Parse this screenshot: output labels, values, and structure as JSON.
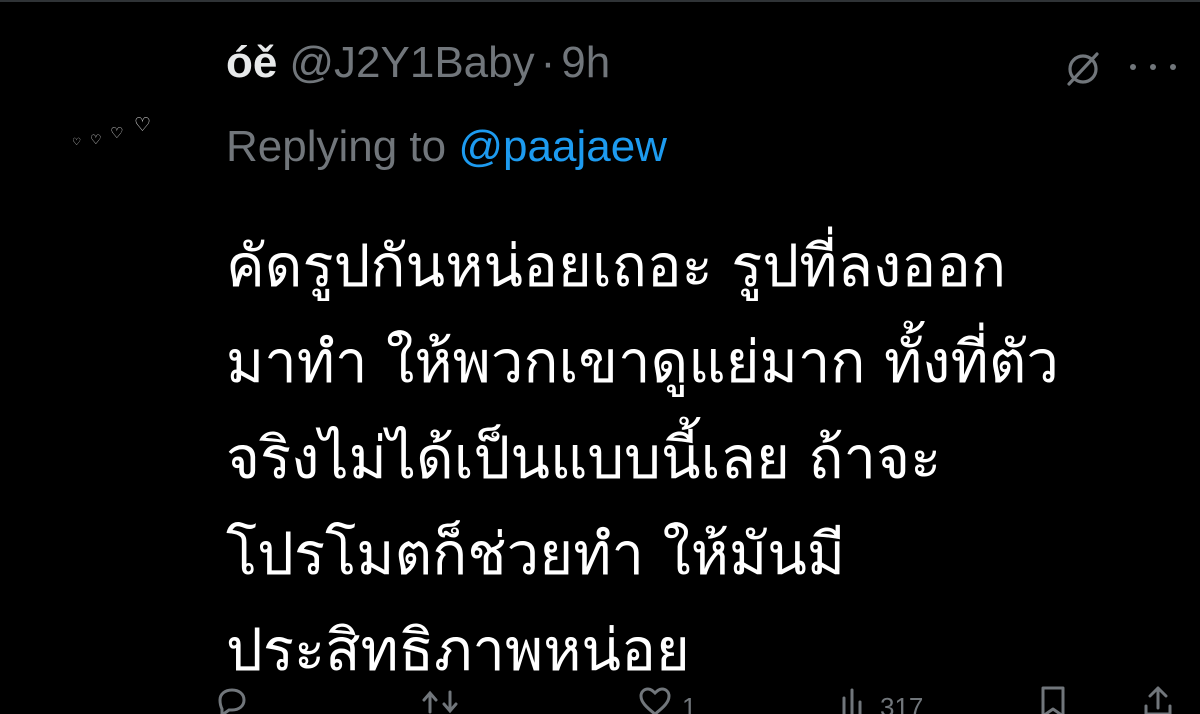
{
  "tweet": {
    "display_name": "óě",
    "handle": "@J2Y1Baby",
    "separator": "·",
    "time": "9h",
    "reply_prefix": "Replying to",
    "reply_mention": "@paajaew",
    "text_lines": [
      "คัดรูปกันหน่อยเถอะ รูปที่ลงออก",
      "มาทำ ให้พวกเขาดูแย่มาก ทั้งที่ตัว",
      "จริงไม่ได้เป็นแบบนี้เลย ถ้าจะ",
      "โปรโมตก็ช่วยทำ ให้มันมี",
      "ประสิทธิภาพหน่อย"
    ],
    "avatar_hearts": "♡♡♡♡"
  },
  "actions": {
    "reply_count": "",
    "retweet_count": "",
    "like_count": "1",
    "views_count": "317"
  },
  "icons": {
    "grok": "grok-icon",
    "more": "more-icon",
    "reply": "reply-icon",
    "retweet": "retweet-icon",
    "like": "heart-icon",
    "views": "views-icon",
    "bookmark": "bookmark-icon",
    "share": "share-icon"
  },
  "colors": {
    "background": "#000000",
    "text": "#ffffff",
    "muted": "#71767b",
    "link": "#1d9bf0"
  }
}
